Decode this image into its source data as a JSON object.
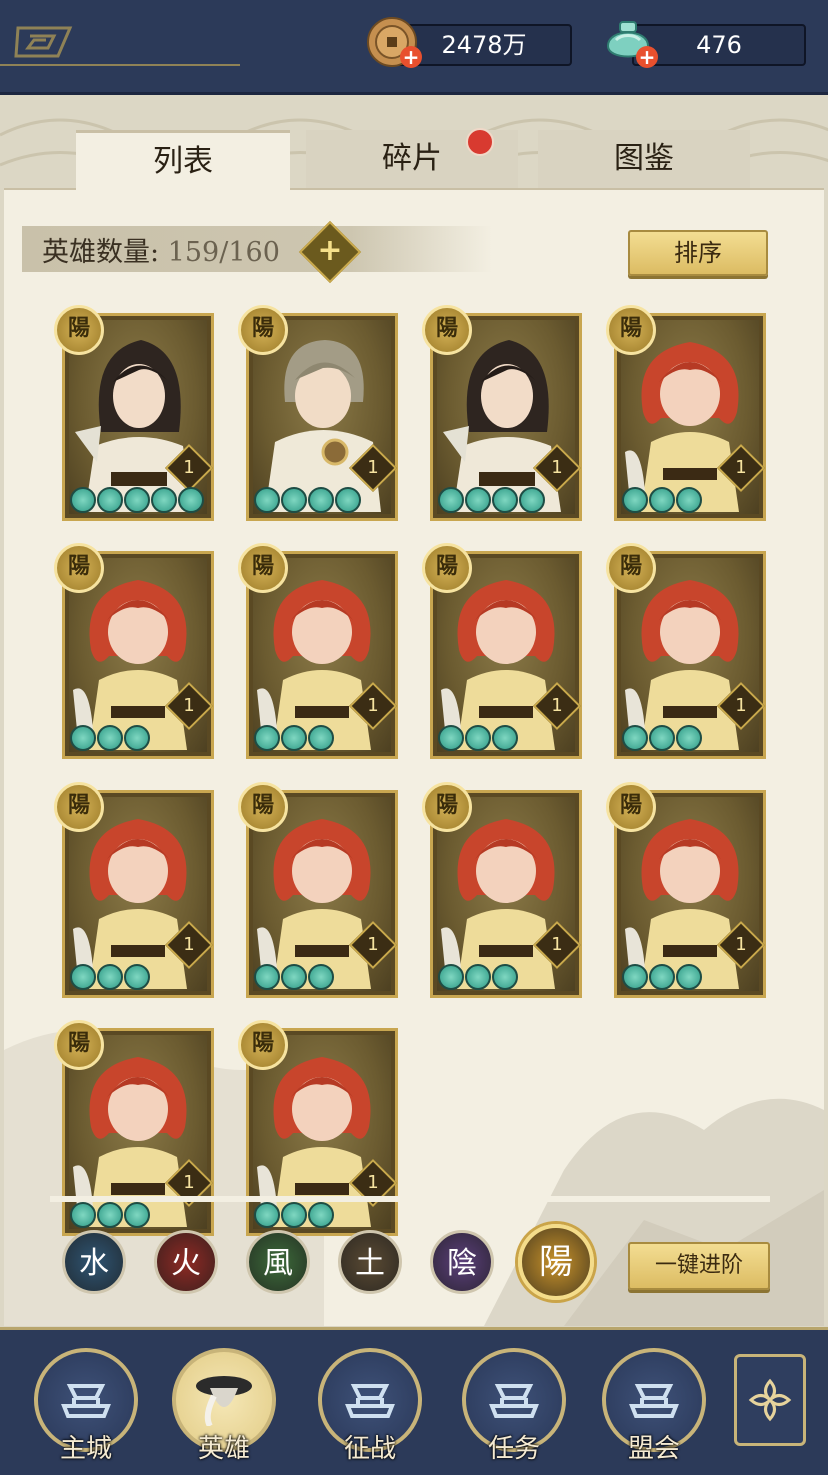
{
  "resources": {
    "coins": "2478万",
    "jade": "476"
  },
  "tabs": [
    {
      "label": "列表",
      "active": true
    },
    {
      "label": "碎片",
      "active": false,
      "badge": true
    },
    {
      "label": "图鉴",
      "active": false
    }
  ],
  "hero_count": {
    "label": "英雄数量:",
    "value": "159/160"
  },
  "sort_button": "排序",
  "upgrade_all_button": "一键进阶",
  "heroes": [
    {
      "faction": "陽",
      "level": "1",
      "stars": 5,
      "portrait": "dark-hair-woman"
    },
    {
      "faction": "陽",
      "level": "1",
      "stars": 4,
      "portrait": "gray-hair-man"
    },
    {
      "faction": "陽",
      "level": "1",
      "stars": 4,
      "portrait": "dark-hair-woman"
    },
    {
      "faction": "陽",
      "level": "1",
      "stars": 3,
      "portrait": "red-hair-girl"
    },
    {
      "faction": "陽",
      "level": "1",
      "stars": 3,
      "portrait": "red-hair-girl"
    },
    {
      "faction": "陽",
      "level": "1",
      "stars": 3,
      "portrait": "red-hair-girl"
    },
    {
      "faction": "陽",
      "level": "1",
      "stars": 3,
      "portrait": "red-hair-girl"
    },
    {
      "faction": "陽",
      "level": "1",
      "stars": 3,
      "portrait": "red-hair-girl"
    },
    {
      "faction": "陽",
      "level": "1",
      "stars": 3,
      "portrait": "red-hair-girl"
    },
    {
      "faction": "陽",
      "level": "1",
      "stars": 3,
      "portrait": "red-hair-girl"
    },
    {
      "faction": "陽",
      "level": "1",
      "stars": 3,
      "portrait": "red-hair-girl"
    },
    {
      "faction": "陽",
      "level": "1",
      "stars": 3,
      "portrait": "red-hair-girl"
    },
    {
      "faction": "陽",
      "level": "1",
      "stars": 3,
      "portrait": "red-hair-girl"
    },
    {
      "faction": "陽",
      "level": "1",
      "stars": 3,
      "portrait": "red-hair-girl"
    }
  ],
  "element_filters": [
    {
      "glyph": "水",
      "name": "water",
      "color": "#2f5573",
      "active": false
    },
    {
      "glyph": "火",
      "name": "fire",
      "color": "#8f2a24",
      "active": false
    },
    {
      "glyph": "風",
      "name": "wind",
      "color": "#3d6b3a",
      "active": false
    },
    {
      "glyph": "土",
      "name": "earth",
      "color": "#5a4a33",
      "active": false
    },
    {
      "glyph": "陰",
      "name": "yin",
      "color": "#5b3f7a",
      "active": false
    },
    {
      "glyph": "陽",
      "name": "yang",
      "color": "#c9932a",
      "active": true
    }
  ],
  "nav": [
    {
      "label": "主城",
      "icon": "city-icon",
      "active": false
    },
    {
      "label": "英雄",
      "icon": "hero-icon",
      "active": true
    },
    {
      "label": "征战",
      "icon": "battle-icon",
      "active": false
    },
    {
      "label": "任务",
      "icon": "quest-icon",
      "active": false
    },
    {
      "label": "盟会",
      "icon": "guild-icon",
      "active": false
    }
  ],
  "colors": {
    "navy": "#2c3a59",
    "parchment": "#f3efe2",
    "gold": "#c8a650",
    "badge_red": "#d83a30"
  }
}
